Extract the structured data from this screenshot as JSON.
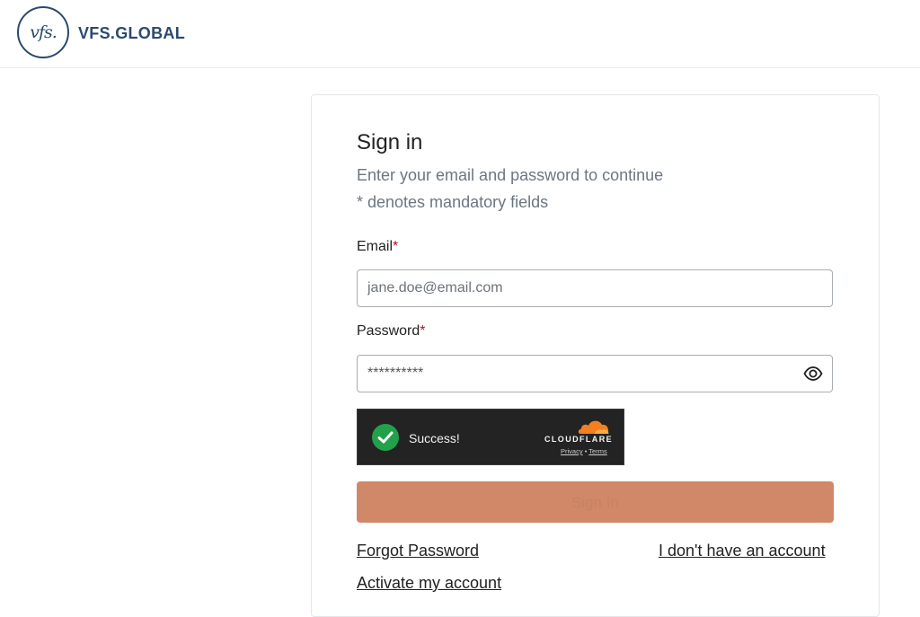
{
  "brand": {
    "logo_mark": "vfs.",
    "name": "VFS.GLOBAL",
    "color": "#2b4a6f"
  },
  "form": {
    "title": "Sign in",
    "subtitle": "Enter your email and password to continue",
    "mandatory_note": "* denotes mandatory fields",
    "email_label": "Email",
    "email_placeholder": "jane.doe@email.com",
    "password_label": "Password",
    "password_value": "**********",
    "required_marker": "*",
    "required_color": "#a5162d",
    "show_password_icon": "eye-icon"
  },
  "captcha": {
    "status": "Success!",
    "brand": "CLOUDFLARE",
    "privacy": "Privacy",
    "separator": "•",
    "terms": "Terms",
    "check_color": "#22a04a"
  },
  "actions": {
    "sign_in_label": "Sign In",
    "sign_in_color": "#d08868",
    "forgot_password": "Forgot Password",
    "no_account": "I don't have an account",
    "activate": "Activate my account"
  }
}
